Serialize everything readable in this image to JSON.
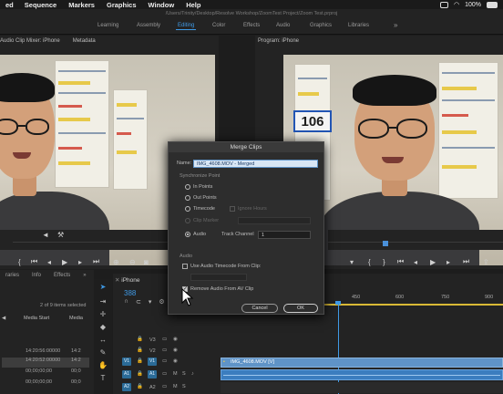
{
  "menubar": {
    "items": [
      "ed",
      "Sequence",
      "Markers",
      "Graphics",
      "Window",
      "Help"
    ],
    "battery": "100%"
  },
  "workspace": {
    "path": "/Users/Trinity/Desktop/Resolve Workshop/ZoomTest Project/Zoom Test.prproj",
    "tabs": [
      "Learning",
      "Assembly",
      "Editing",
      "Color",
      "Effects",
      "Audio",
      "Graphics",
      "Libraries"
    ],
    "active": "Editing",
    "more": "»"
  },
  "source_monitor": {
    "tabs": [
      "Audio Clip Mixer: iPhone",
      "Metadata"
    ]
  },
  "program_monitor": {
    "title": "Program: iPhone",
    "badge": "106"
  },
  "project_panel": {
    "tabs": [
      "raries",
      "Info",
      "Effects",
      "»"
    ],
    "count": "2 of 9 items selected",
    "columns": [
      "Media Start",
      "Media"
    ],
    "rows": [
      [
        "14:20:56:00000",
        "14:2"
      ],
      [
        "14:20:52:00000",
        "14:2"
      ],
      [
        "00;00;00;00",
        "00;0"
      ],
      [
        "00;00;00;00",
        "00;0"
      ]
    ]
  },
  "timeline": {
    "sequence": "iPhone",
    "timecode": "388",
    "ruler": [
      "450",
      "600",
      "750",
      "900"
    ],
    "tracks": [
      "V3",
      "V2",
      "V1",
      "A1",
      "A2"
    ],
    "clip_label": "IMG_4608.MOV [V]"
  },
  "dialog": {
    "title": "Merge Clips",
    "name_label": "Name:",
    "name_value": "IMG_4608.MOV - Merged",
    "sync_label": "Synchronize Point",
    "options": [
      "In Points",
      "Out Points",
      "Timecode",
      "Clip Marker",
      "Audio"
    ],
    "ignore_hours": "Ignore Hours",
    "track_channel_label": "Track Channel",
    "track_channel_value": "1",
    "audio_section": "Audio",
    "use_audio_tc": "Use Audio Timecode From Clip:",
    "remove_audio": "Remove Audio From AV Clip",
    "cancel": "Cancel",
    "ok": "OK"
  }
}
